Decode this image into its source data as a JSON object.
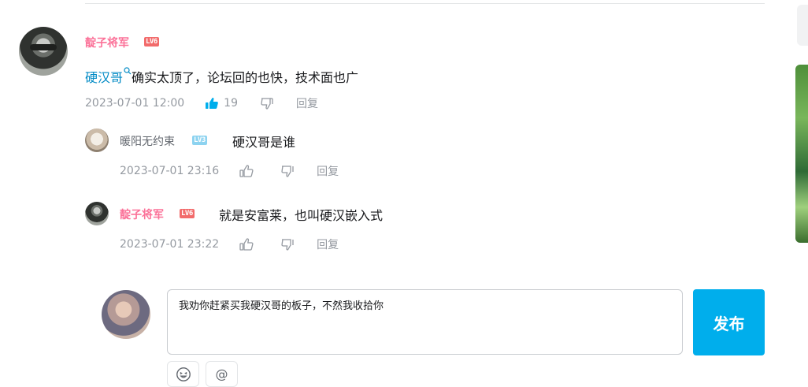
{
  "main_comment": {
    "username": "靛子将军",
    "level": "LV6",
    "mention": "硬汉哥",
    "text": "确实太顶了，论坛回的也快，技术面也广",
    "time": "2023-07-01 12:00",
    "likes": "19",
    "reply_label": "回复"
  },
  "replies": [
    {
      "username": "暖阳无约束",
      "level": "LV3",
      "text": "硬汉哥是谁",
      "time": "2023-07-01 23:16",
      "reply_label": "回复"
    },
    {
      "username": "靛子将军",
      "level": "LV6",
      "text": "就是安富莱，也叫硬汉嵌入式",
      "time": "2023-07-01 23:22",
      "reply_label": "回复"
    }
  ],
  "composer": {
    "value": "我劝你赶紧买我硬汉哥的板子，不然我收拾你",
    "publish_label": "发布",
    "at_label": "@"
  },
  "colors": {
    "accent": "#00aeec",
    "vip_name": "#fb7299",
    "mention": "#008ac5"
  },
  "icons": [
    "thumb-up-icon",
    "thumb-down-icon",
    "emoji-icon",
    "at-icon",
    "search-icon"
  ]
}
